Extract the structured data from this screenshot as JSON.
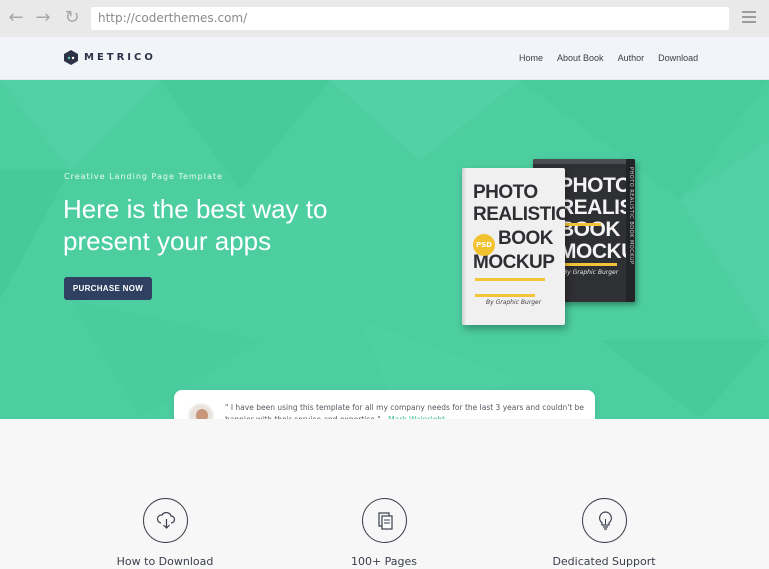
{
  "browser": {
    "url": "http://coderthemes.com/",
    "back_icon": "arrow-left-icon",
    "forward_icon": "arrow-right-icon",
    "reload_icon": "reload-icon",
    "menu_icon": "hamburger-menu-icon"
  },
  "navbar": {
    "logo_text": "METRICO",
    "links": [
      "Home",
      "About Book",
      "Author",
      "Download"
    ]
  },
  "hero": {
    "kicker": "Creative Landing Page Template",
    "headline": "Here is the best way to present your apps",
    "cta_label": "PURCHASE NOW",
    "bg_color": "#4ccea0",
    "book_front": {
      "title_lines": [
        "PHOTO",
        "REALISTIC",
        "BOOK",
        "MOCKUP"
      ],
      "badge": "PSD",
      "author": "By Graphic Burger"
    },
    "book_back": {
      "title_lines": [
        "PHOTO",
        "REALISTIC",
        "BOOK",
        "MOCKUP"
      ],
      "author": "By Graphic Burger",
      "spine": "PHOTO REALISTIC BOOK MOCKUP"
    }
  },
  "testimonial": {
    "quote": "\" I have been using this template for all my company needs for the last 3 years and couldn't be happier with their service and expertise.\" - ",
    "name": "Mark Wainright"
  },
  "features": [
    {
      "icon": "cloud-download-icon",
      "label": "How to Download"
    },
    {
      "icon": "documents-icon",
      "label": "100+ Pages"
    },
    {
      "icon": "lightbulb-icon",
      "label": "Dedicated Support"
    }
  ],
  "colors": {
    "accent": "#4ccea0",
    "button": "#2f4160",
    "text_dark": "#3a3f4b",
    "quote_name": "#3fbf92"
  }
}
